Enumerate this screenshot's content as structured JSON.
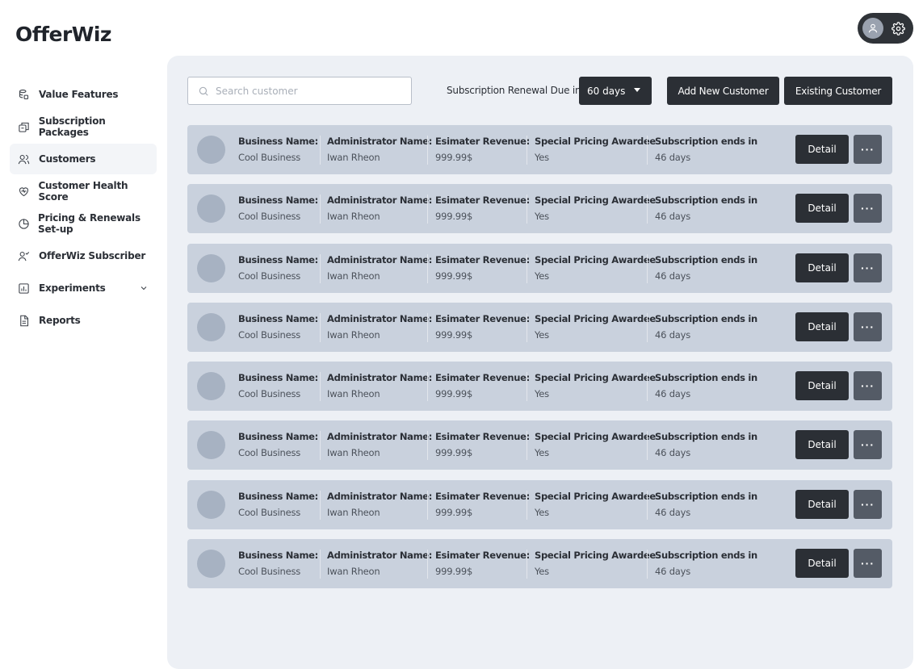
{
  "app": {
    "logo": "OfferWiz"
  },
  "sidebar": {
    "items": [
      {
        "label": "Value Features",
        "icon": "database-stack-icon",
        "active": false
      },
      {
        "label": "Subscription Packages",
        "icon": "package-icon",
        "active": false
      },
      {
        "label": "Customers",
        "icon": "users-icon",
        "active": true
      },
      {
        "label": "Customer Health Score",
        "icon": "heart-pulse-icon",
        "active": false
      },
      {
        "label": "Pricing & Renewals Set-up",
        "icon": "pie-chart-icon",
        "active": false
      },
      {
        "label": "OfferWiz Subscriber",
        "icon": "user-check-icon",
        "active": false
      },
      {
        "label": "Experiments",
        "icon": "bar-chart-icon",
        "active": false,
        "expandable": true
      },
      {
        "label": "Reports",
        "icon": "document-icon",
        "active": false
      }
    ]
  },
  "toolbar": {
    "search_placeholder": "Search customer",
    "renewal_label": "Subscription Renewal Due in:",
    "renewal_value": "60 days",
    "add_customer_label": "Add New Customer",
    "existing_customer_label": "Existing Customer"
  },
  "labels": {
    "business": "Business Name:",
    "admin": "Administrator Name:",
    "revenue": "Esimater Revenue:",
    "special": "Special Pricing Awardee",
    "ends": "Subscription ends in",
    "detail": "Detail",
    "more": "···"
  },
  "customers": [
    {
      "business": "Cool Business",
      "admin": "Iwan Rheon",
      "revenue": "999.99$",
      "special": "Yes",
      "ends": "46 days"
    },
    {
      "business": "Cool Business",
      "admin": "Iwan Rheon",
      "revenue": "999.99$",
      "special": "Yes",
      "ends": "46 days"
    },
    {
      "business": "Cool Business",
      "admin": "Iwan Rheon",
      "revenue": "999.99$",
      "special": "Yes",
      "ends": "46 days"
    },
    {
      "business": "Cool Business",
      "admin": "Iwan Rheon",
      "revenue": "999.99$",
      "special": "Yes",
      "ends": "46 days"
    },
    {
      "business": "Cool Business",
      "admin": "Iwan Rheon",
      "revenue": "999.99$",
      "special": "Yes",
      "ends": "46 days"
    },
    {
      "business": "Cool Business",
      "admin": "Iwan Rheon",
      "revenue": "999.99$",
      "special": "Yes",
      "ends": "46 days"
    },
    {
      "business": "Cool Business",
      "admin": "Iwan Rheon",
      "revenue": "999.99$",
      "special": "Yes",
      "ends": "46 days"
    },
    {
      "business": "Cool Business",
      "admin": "Iwan Rheon",
      "revenue": "999.99$",
      "special": "Yes",
      "ends": "46 days"
    }
  ],
  "colors": {
    "dark": "#2b2f35",
    "row_bg": "#c9d1dd",
    "panel_bg": "#edf0f5",
    "more_btn": "#545b66"
  }
}
